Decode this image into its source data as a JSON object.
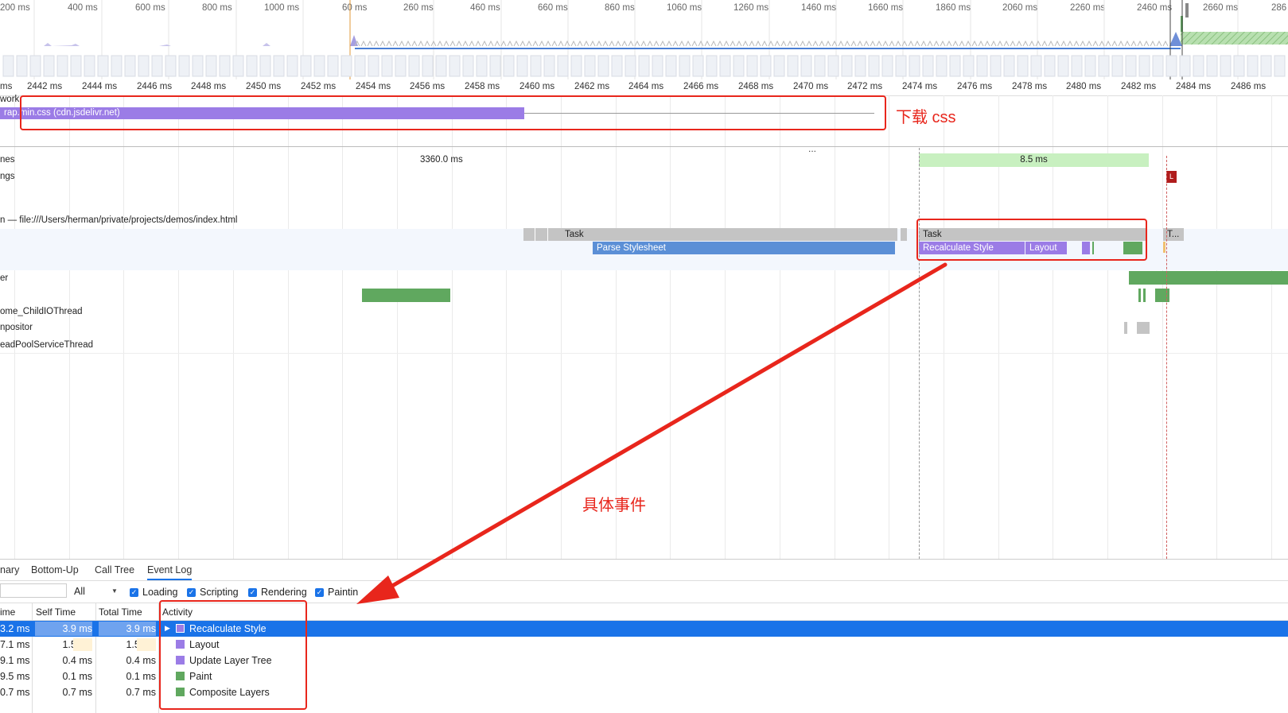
{
  "overview": {
    "left_labels": [
      "200 ms",
      "400 ms",
      "600 ms",
      "800 ms",
      "1000 ms",
      "60 ms"
    ],
    "right_labels": [
      "260 ms",
      "460 ms",
      "660 ms",
      "860 ms",
      "1060 ms",
      "1260 ms",
      "1460 ms",
      "1660 ms",
      "1860 ms",
      "2060 ms",
      "2260 ms",
      "2460 ms",
      "2660 ms",
      "286"
    ]
  },
  "ruler": {
    "labels": [
      "ms",
      "2442 ms",
      "2444 ms",
      "2446 ms",
      "2448 ms",
      "2450 ms",
      "2452 ms",
      "2454 ms",
      "2456 ms",
      "2458 ms",
      "2460 ms",
      "2462 ms",
      "2464 ms",
      "2466 ms",
      "2468 ms",
      "2470 ms",
      "2472 ms",
      "2474 ms",
      "2476 ms",
      "2478 ms",
      "2480 ms",
      "2482 ms",
      "2484 ms",
      "2486 ms"
    ]
  },
  "tracks": {
    "network": "work",
    "network_request": "rap.min.css (cdn.jsdelivr.net)",
    "frames": "nes",
    "frames_long": "3360.0 ms",
    "frames_short": "8.5 ms",
    "timings": "ngs",
    "timing_marker": "L",
    "main": "n — file:///Users/herman/private/projects/demos/index.html",
    "raster": "er",
    "child_io": "ome_ChildIOThread",
    "compositor": "npositor",
    "threadpool": "eadPoolServiceThread",
    "ellipsis": "..."
  },
  "flame": {
    "task1": "Task",
    "parse": "Parse Stylesheet",
    "task2": "Task",
    "recalc": "Recalculate Style",
    "layout": "Layout",
    "task3": "T..."
  },
  "annotations": {
    "download_css": "下载 css",
    "specific_events": "具体事件"
  },
  "bottom": {
    "tabs": [
      "nary",
      "Bottom-Up",
      "Call Tree",
      "Event Log"
    ],
    "filter_value": "All",
    "checkboxes": [
      "Loading",
      "Scripting",
      "Rendering",
      "Paintin"
    ],
    "columns": {
      "start": "ime",
      "self": "Self Time",
      "total": "Total Time",
      "activity": "Activity"
    },
    "rows": [
      {
        "start": "3.2 ms",
        "self": "3.9 ms",
        "total": "3.9 ms",
        "activity": "Recalculate Style",
        "color": "#9b7ce6"
      },
      {
        "start": "7.1 ms",
        "self": "1.5 ms",
        "total": "1.5 ms",
        "activity": "Layout",
        "color": "#9b7ce6"
      },
      {
        "start": "9.1 ms",
        "self": "0.4 ms",
        "total": "0.4 ms",
        "activity": "Update Layer Tree",
        "color": "#9b7ce6"
      },
      {
        "start": "9.5 ms",
        "self": "0.1 ms",
        "total": "0.1 ms",
        "activity": "Paint",
        "color": "#60a85f"
      },
      {
        "start": "0.7 ms",
        "self": "0.7 ms",
        "total": "0.7 ms",
        "activity": "Composite Layers",
        "color": "#60a85f"
      }
    ]
  }
}
